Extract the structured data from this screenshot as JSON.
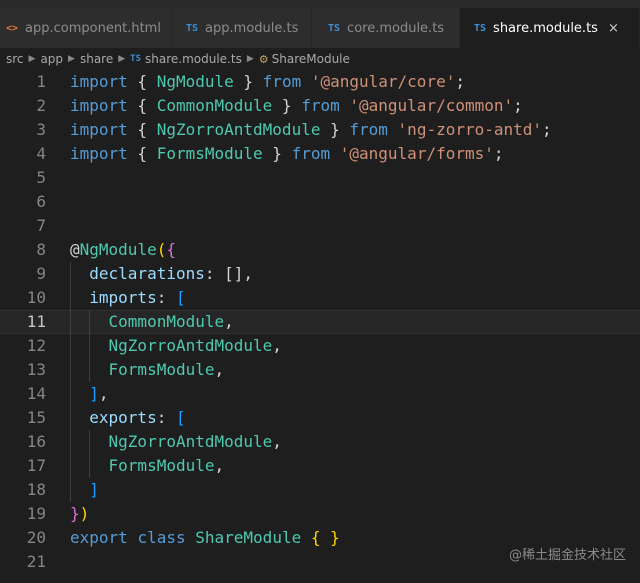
{
  "tabs": [
    {
      "icon": "<>",
      "label": "app.component.html",
      "type": "html",
      "active": false
    },
    {
      "icon": "TS",
      "label": "app.module.ts",
      "type": "ts",
      "active": false
    },
    {
      "icon": "TS",
      "label": "core.module.ts",
      "type": "ts",
      "active": false
    },
    {
      "icon": "TS",
      "label": "share.module.ts",
      "type": "ts",
      "active": true,
      "close": "×"
    }
  ],
  "breadcrumb": {
    "src": "src",
    "app": "app",
    "share": "share",
    "file_icon": "TS",
    "file": "share.module.ts",
    "symbol": "ShareModule"
  },
  "editor": {
    "current_line": 11,
    "lines": [
      {
        "n": "1",
        "parts": [
          [
            "kw",
            "import"
          ],
          [
            "p",
            " { "
          ],
          [
            "cls",
            "NgModule"
          ],
          [
            "p",
            " } "
          ],
          [
            "kw",
            "from"
          ],
          [
            "p",
            " "
          ],
          [
            "str",
            "'@angular/core'"
          ],
          [
            "p",
            ";"
          ]
        ]
      },
      {
        "n": "2",
        "parts": [
          [
            "kw",
            "import"
          ],
          [
            "p",
            " { "
          ],
          [
            "cls",
            "CommonModule"
          ],
          [
            "p",
            " } "
          ],
          [
            "kw",
            "from"
          ],
          [
            "p",
            " "
          ],
          [
            "str",
            "'@angular/common'"
          ],
          [
            "p",
            ";"
          ]
        ]
      },
      {
        "n": "3",
        "parts": [
          [
            "kw",
            "import"
          ],
          [
            "p",
            " { "
          ],
          [
            "cls",
            "NgZorroAntdModule"
          ],
          [
            "p",
            " } "
          ],
          [
            "kw",
            "from"
          ],
          [
            "p",
            " "
          ],
          [
            "str",
            "'ng-zorro-antd'"
          ],
          [
            "p",
            ";"
          ]
        ]
      },
      {
        "n": "4",
        "parts": [
          [
            "kw",
            "import"
          ],
          [
            "p",
            " { "
          ],
          [
            "cls",
            "FormsModule"
          ],
          [
            "p",
            " } "
          ],
          [
            "kw",
            "from"
          ],
          [
            "p",
            " "
          ],
          [
            "str",
            "'@angular/forms'"
          ],
          [
            "p",
            ";"
          ]
        ]
      },
      {
        "n": "5",
        "parts": []
      },
      {
        "n": "6",
        "parts": []
      },
      {
        "n": "7",
        "parts": []
      },
      {
        "n": "8",
        "parts": [
          [
            "p",
            "@"
          ],
          [
            "cls",
            "NgModule"
          ],
          [
            "brace",
            "("
          ],
          [
            "brace2",
            "{"
          ]
        ]
      },
      {
        "n": "9",
        "parts": [
          [
            "p",
            "  "
          ],
          [
            "prop",
            "declarations"
          ],
          [
            "p",
            ": [],"
          ]
        ]
      },
      {
        "n": "10",
        "parts": [
          [
            "p",
            "  "
          ],
          [
            "prop",
            "imports"
          ],
          [
            "p",
            ": "
          ],
          [
            "brace3",
            "["
          ]
        ]
      },
      {
        "n": "11",
        "parts": [
          [
            "p",
            "    "
          ],
          [
            "cls",
            "CommonModule"
          ],
          [
            "p",
            ","
          ]
        ]
      },
      {
        "n": "12",
        "parts": [
          [
            "p",
            "    "
          ],
          [
            "cls",
            "NgZorroAntdModule"
          ],
          [
            "p",
            ","
          ]
        ]
      },
      {
        "n": "13",
        "parts": [
          [
            "p",
            "    "
          ],
          [
            "cls",
            "FormsModule"
          ],
          [
            "p",
            ","
          ]
        ]
      },
      {
        "n": "14",
        "parts": [
          [
            "p",
            "  "
          ],
          [
            "brace3",
            "]"
          ],
          [
            "p",
            ","
          ]
        ]
      },
      {
        "n": "15",
        "parts": [
          [
            "p",
            "  "
          ],
          [
            "prop",
            "exports"
          ],
          [
            "p",
            ": "
          ],
          [
            "brace3",
            "["
          ]
        ]
      },
      {
        "n": "16",
        "parts": [
          [
            "p",
            "    "
          ],
          [
            "cls",
            "NgZorroAntdModule"
          ],
          [
            "p",
            ","
          ]
        ]
      },
      {
        "n": "17",
        "parts": [
          [
            "p",
            "    "
          ],
          [
            "cls",
            "FormsModule"
          ],
          [
            "p",
            ","
          ]
        ]
      },
      {
        "n": "18",
        "parts": [
          [
            "p",
            "  "
          ],
          [
            "brace3",
            "]"
          ]
        ]
      },
      {
        "n": "19",
        "parts": [
          [
            "brace2",
            "}"
          ],
          [
            "brace",
            ")"
          ]
        ]
      },
      {
        "n": "20",
        "parts": [
          [
            "kw",
            "export"
          ],
          [
            "p",
            " "
          ],
          [
            "kw",
            "class"
          ],
          [
            "p",
            " "
          ],
          [
            "cls",
            "ShareModule"
          ],
          [
            "p",
            " "
          ],
          [
            "brace",
            "{"
          ],
          [
            "p",
            " "
          ],
          [
            "brace",
            "}"
          ]
        ]
      },
      {
        "n": "21",
        "parts": []
      }
    ]
  },
  "watermark": "@稀土掘金技术社区",
  "colors": {
    "keyword": "#569cd6",
    "class": "#4ec9b0",
    "string": "#ce9178",
    "property": "#9cdcfe",
    "bracket_gold": "#ffd700",
    "bracket_orchid": "#da70d6",
    "bracket_blue": "#179fff",
    "background": "#1e1e1e"
  }
}
